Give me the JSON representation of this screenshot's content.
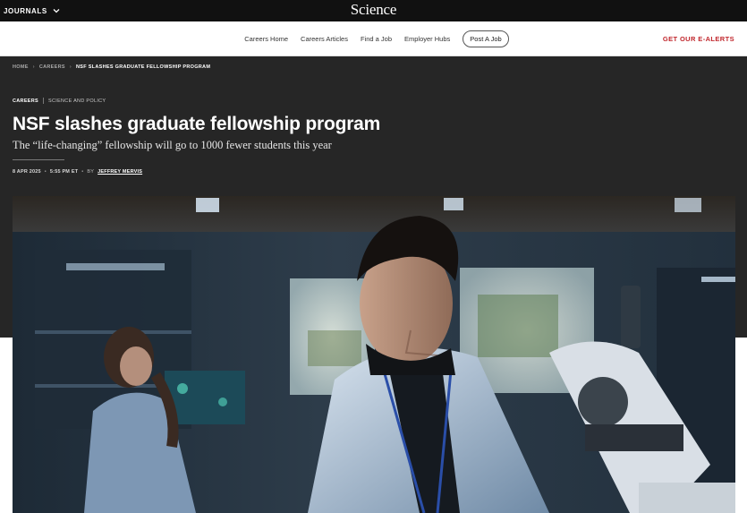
{
  "topbar": {
    "journals_label": "JOURNALS",
    "logo_text": "Science"
  },
  "nav": {
    "links": [
      "Careers Home",
      "Careers Articles",
      "Find a Job",
      "Employer Hubs"
    ],
    "post_job": "Post A Job",
    "ealerts": "GET OUR E-ALERTS"
  },
  "breadcrumb": {
    "home": "HOME",
    "careers": "CAREERS",
    "current": "NSF SLASHES GRADUATE FELLOWSHIP PROGRAM"
  },
  "article": {
    "tag_primary": "CAREERS",
    "tag_secondary": "SCIENCE AND POLICY",
    "headline": "NSF slashes graduate fellowship program",
    "dek": "The “life-changing” fellowship will go to 1000 fewer students this year",
    "date": "8 APR 2025",
    "time": "5:55 PM ET",
    "by": "BY",
    "author": "JEFFREY MERVIS"
  },
  "hero_image": {
    "description_icon": "lab-photo-image"
  },
  "colors": {
    "topbar_bg": "#111111",
    "hero_bg": "#262626",
    "ealerts": "#c1272d"
  }
}
